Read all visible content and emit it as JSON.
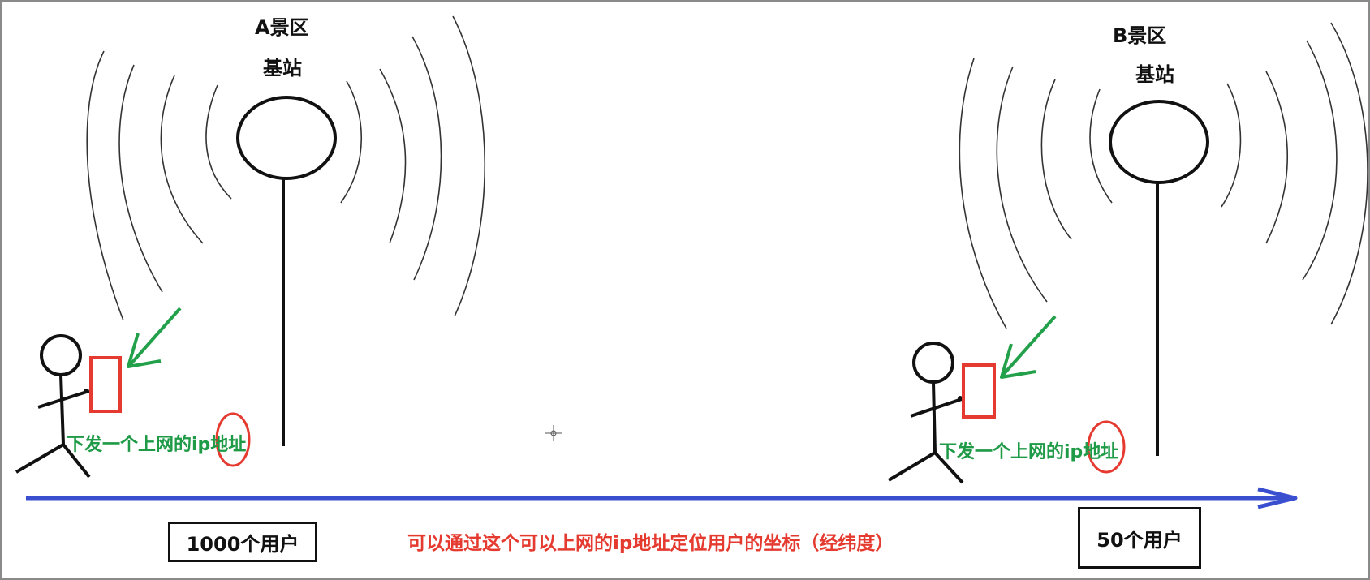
{
  "station_a": {
    "title": "A景区",
    "subtitle": "基站",
    "note": "下发一个上网的ip地址",
    "user_count": "1000个用户"
  },
  "station_b": {
    "title": "B景区",
    "subtitle": "基站",
    "note": "下发一个上网的ip地址",
    "user_count": "50个用户"
  },
  "caption": "可以通过这个可以上网的ip地址定位用户的坐标（经纬度）",
  "colors": {
    "ink": "#111111",
    "arrow_green": "#23a04a",
    "phone_red": "#e53a2f",
    "axis_blue": "#3a4fd0",
    "note_green": "#1f9a47",
    "caption_red": "#e53a2f"
  }
}
